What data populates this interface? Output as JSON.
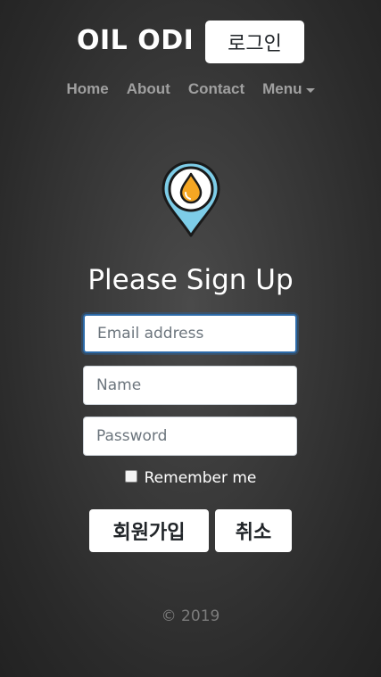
{
  "header": {
    "brand": "OIL ODI",
    "login_label": "로그인"
  },
  "nav": {
    "items": [
      {
        "label": "Home"
      },
      {
        "label": "About"
      },
      {
        "label": "Contact"
      },
      {
        "label": "Menu"
      }
    ]
  },
  "logo": {
    "icon": "oil-drop-pin-icon",
    "colors": {
      "pin": "#7dcde8",
      "drop": "#f5a623",
      "outline": "#1a1a1a"
    }
  },
  "form": {
    "title": "Please Sign Up",
    "email_placeholder": "Email address",
    "name_placeholder": "Name",
    "password_placeholder": "Password",
    "remember_label": "Remember me",
    "remember_checked": false,
    "signup_label": "회원가입",
    "cancel_label": "취소"
  },
  "footer": {
    "copyright": "© 2019"
  }
}
